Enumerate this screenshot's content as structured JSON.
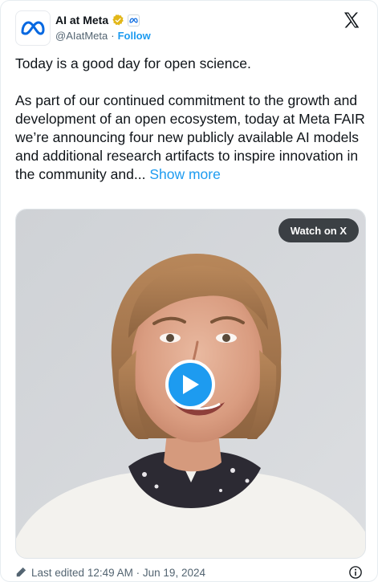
{
  "author": {
    "display_name": "AI at Meta",
    "handle": "@AIatMeta",
    "separator": "·",
    "follow_label": "Follow",
    "avatar_icon": "meta-infinity-logo",
    "verified_icon": "gold-verified-badge",
    "affiliation_icon": "meta-affiliate-badge"
  },
  "tweet": {
    "line1": "Today is a good day for open science.",
    "line2": "As part of our continued commitment to the growth and development of an open ecosystem, today at Meta FAIR we’re announcing four new publicly available AI models and additional research artifacts to inspire innovation in the community and...",
    "show_more": "Show more"
  },
  "media": {
    "watch_label": "Watch on X",
    "play_icon": "play-icon"
  },
  "footer": {
    "edited_prefix": "Last edited",
    "time": "12:49 AM",
    "separator": "·",
    "date": "Jun 19, 2024",
    "info_icon": "info-icon"
  },
  "colors": {
    "accent": "#1d9bf0",
    "verified_gold": "#e2b719",
    "meta_blue": "#0668e1",
    "text": "#0f1419",
    "muted": "#536471"
  }
}
